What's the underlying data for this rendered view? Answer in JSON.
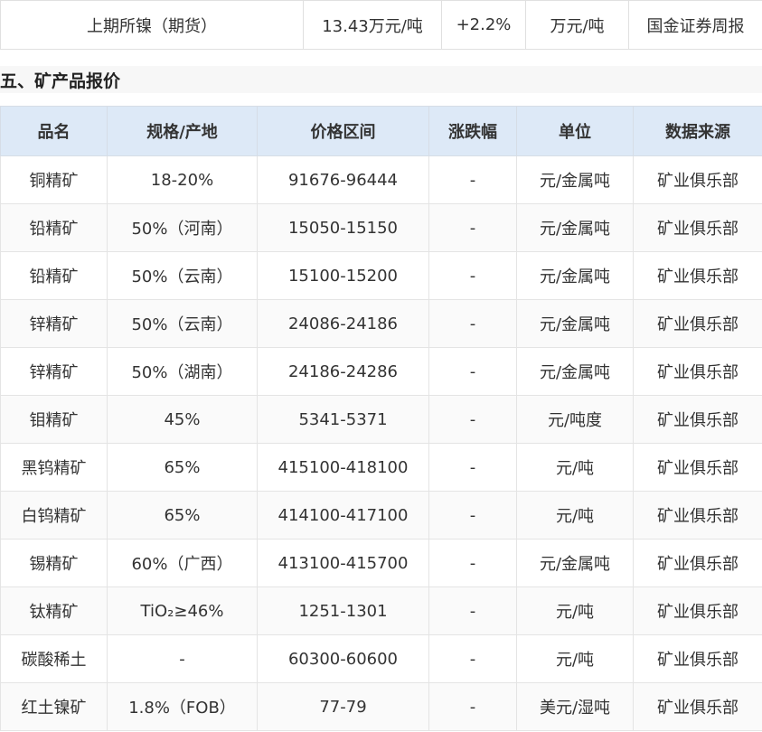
{
  "top_row": {
    "name": "上期所镍（期货）",
    "price": "13.43万元/吨",
    "change": "+2.2%",
    "unit": "万元/吨",
    "source": "国金证券周报"
  },
  "section": {
    "title": "五、矿产品报价"
  },
  "table": {
    "headers": [
      "品名",
      "规格/产地",
      "价格区间",
      "涨跌幅",
      "单位",
      "数据来源"
    ],
    "rows": [
      [
        "铜精矿",
        "18-20%",
        "91676-96444",
        "-",
        "元/金属吨",
        "矿业俱乐部"
      ],
      [
        "铅精矿",
        "50%（河南）",
        "15050-15150",
        "-",
        "元/金属吨",
        "矿业俱乐部"
      ],
      [
        "铅精矿",
        "50%（云南）",
        "15100-15200",
        "-",
        "元/金属吨",
        "矿业俱乐部"
      ],
      [
        "锌精矿",
        "50%（云南）",
        "24086-24186",
        "-",
        "元/金属吨",
        "矿业俱乐部"
      ],
      [
        "锌精矿",
        "50%（湖南）",
        "24186-24286",
        "-",
        "元/金属吨",
        "矿业俱乐部"
      ],
      [
        "钼精矿",
        "45%",
        "5341-5371",
        "-",
        "元/吨度",
        "矿业俱乐部"
      ],
      [
        "黑钨精矿",
        "65%",
        "415100-418100",
        "-",
        "元/吨",
        "矿业俱乐部"
      ],
      [
        "白钨精矿",
        "65%",
        "414100-417100",
        "-",
        "元/吨",
        "矿业俱乐部"
      ],
      [
        "锡精矿",
        "60%（广西）",
        "413100-415700",
        "-",
        "元/金属吨",
        "矿业俱乐部"
      ],
      [
        "钛精矿",
        "TiO₂≥46%",
        "1251-1301",
        "-",
        "元/吨",
        "矿业俱乐部"
      ],
      [
        "碳酸稀土",
        "-",
        "60300-60600",
        "-",
        "元/吨",
        "矿业俱乐部"
      ],
      [
        "红土镍矿",
        "1.8%（FOB）",
        "77-79",
        "-",
        "美元/湿吨",
        "矿业俱乐部"
      ]
    ]
  }
}
